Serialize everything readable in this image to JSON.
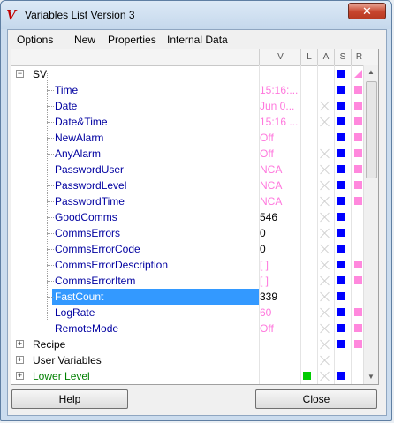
{
  "window": {
    "title": "Variables List Version 3",
    "close_label": "✕"
  },
  "menu": [
    "Options",
    "New",
    "Properties",
    "Internal Data"
  ],
  "columns": {
    "value": "V",
    "l": "L",
    "a": "A",
    "s": "S",
    "r": "R"
  },
  "tree": {
    "group": "SV",
    "items": [
      {
        "name": "Time",
        "value": "15:16:...",
        "value_color": "pink"
      },
      {
        "name": "Date",
        "value": "Jun 0...",
        "value_color": "pink"
      },
      {
        "name": "Date&Time",
        "value": "15:16 ...",
        "value_color": "pink"
      },
      {
        "name": "NewAlarm",
        "value": "Off",
        "value_color": "pink"
      },
      {
        "name": "AnyAlarm",
        "value": "Off",
        "value_color": "pink"
      },
      {
        "name": "PasswordUser",
        "value": "NCA",
        "value_color": "pink"
      },
      {
        "name": "PasswordLevel",
        "value": "NCA",
        "value_color": "pink"
      },
      {
        "name": "PasswordTime",
        "value": "NCA",
        "value_color": "pink"
      },
      {
        "name": "GoodComms",
        "value": "546",
        "value_color": "black"
      },
      {
        "name": "CommsErrors",
        "value": "0",
        "value_color": "black"
      },
      {
        "name": "CommsErrorCode",
        "value": "0",
        "value_color": "black"
      },
      {
        "name": "CommsErrorDescription",
        "value": "[ ]",
        "value_color": "pink"
      },
      {
        "name": "CommsErrorItem",
        "value": "[ ]",
        "value_color": "pink"
      },
      {
        "name": "FastCount",
        "value": "339",
        "value_color": "black",
        "selected": true
      },
      {
        "name": "LogRate",
        "value": "60",
        "value_color": "pink"
      },
      {
        "name": "RemoteMode",
        "value": "Off",
        "value_color": "pink"
      }
    ],
    "other_groups": [
      "Recipe",
      "User Variables",
      "Lower Level"
    ]
  },
  "buttons": {
    "help": "Help",
    "close": "Close"
  },
  "colors": {
    "selection": "#3399ff",
    "status_blue": "#0000ff",
    "status_pink": "#ff88dd",
    "status_green": "#00cc00",
    "value_pink": "#ff77dd",
    "child_text": "#0000a0",
    "lower_level_text": "#008000"
  }
}
